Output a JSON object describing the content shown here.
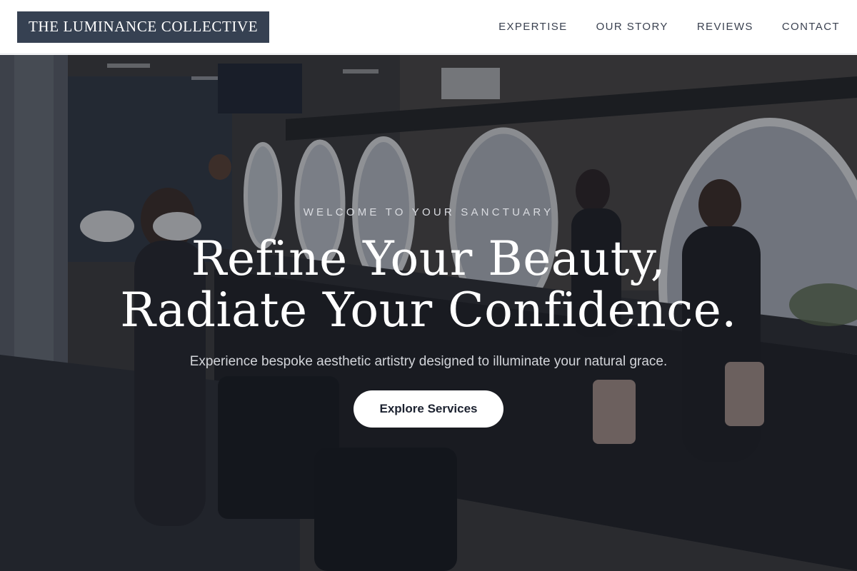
{
  "header": {
    "brand": "THE LUMINANCE COLLECTIVE",
    "nav": [
      {
        "label": "EXPERTISE"
      },
      {
        "label": "OUR STORY"
      },
      {
        "label": "REVIEWS"
      },
      {
        "label": "CONTACT"
      }
    ]
  },
  "hero": {
    "eyebrow": "WELCOME TO YOUR SANCTUARY",
    "title_line1": "Refine Your Beauty,",
    "title_line2": "Radiate Your Confidence.",
    "subtitle": "Experience bespoke aesthetic artistry designed to illuminate your natural grace.",
    "cta_label": "Explore Services",
    "background_image": "salon-interior-photo"
  },
  "colors": {
    "brand_bg": "#364152",
    "nav_text": "#3a4150",
    "hero_overlay": "#141822",
    "cta_bg": "#ffffff",
    "cta_text": "#1c2230"
  }
}
